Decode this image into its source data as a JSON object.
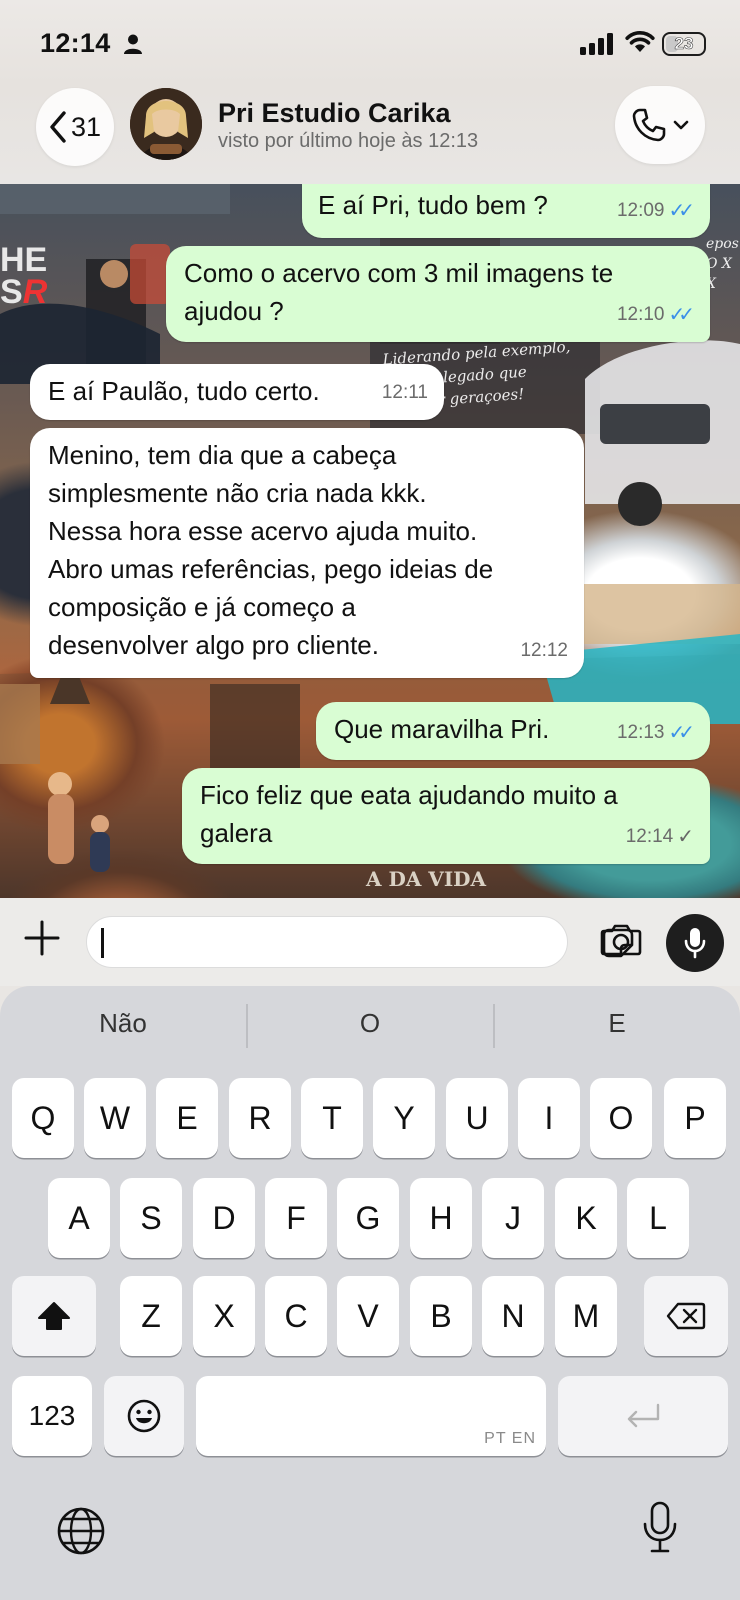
{
  "status_bar": {
    "time": "12:14",
    "battery": "23"
  },
  "header": {
    "back_count": "31",
    "contact_name": "Pri Estudio Carika",
    "last_seen": "visto por último hoje às 12:13"
  },
  "wallpaper": {
    "left_text": "HE",
    "left_text2": "S",
    "left_text_red": "R",
    "right_text": "epos\nO X\nX",
    "quote_lines": [
      "Liderando pela exemplo,",
      "una legado que",
      "rar geraçoes!"
    ],
    "bottom_text": "A DA VIDA"
  },
  "messages": [
    {
      "dir": "out",
      "text": "E aí Pri, tudo bem ?",
      "time": "12:09",
      "status": "read"
    },
    {
      "dir": "out",
      "text": "Como o acervo com 3 mil imagens te ajudou ?",
      "time": "12:10",
      "status": "read"
    },
    {
      "dir": "in",
      "text": "E aí Paulão, tudo certo.",
      "time": "12:11"
    },
    {
      "dir": "in",
      "text": "Menino, tem dia que a cabeça simplesmente não cria nada kkk. Nessa hora esse acervo ajuda muito. Abro umas referências, pego ideias de composição e já começo a desenvolver algo pro cliente.",
      "time": "12:12"
    },
    {
      "dir": "out",
      "text": "Que maravilha Pri.",
      "time": "12:13",
      "status": "read"
    },
    {
      "dir": "out",
      "text": "Fico feliz que eata ajudando muito a galera",
      "time": "12:14",
      "status": "sent"
    }
  ],
  "message_lines": {
    "m2": [
      "Como o acervo com 3 mil imagens te",
      "ajudou ?"
    ],
    "m4": [
      "Menino, tem dia que a cabeça",
      "simplesmente não cria nada kkk.",
      "Nessa hora esse acervo ajuda muito.",
      "Abro umas referências, pego ideias de",
      "composição e já começo a",
      "desenvolver algo pro cliente."
    ],
    "m6": [
      "Fico feliz que eata ajudando muito a",
      "galera"
    ]
  },
  "input": {
    "value": "",
    "placeholder": ""
  },
  "keyboard": {
    "suggestions": [
      "Não",
      "O",
      "E"
    ],
    "row1": [
      "Q",
      "W",
      "E",
      "R",
      "T",
      "Y",
      "U",
      "I",
      "O",
      "P"
    ],
    "row2": [
      "A",
      "S",
      "D",
      "F",
      "G",
      "H",
      "J",
      "K",
      "L"
    ],
    "row3": [
      "Z",
      "X",
      "C",
      "V",
      "B",
      "N",
      "M"
    ],
    "numbers_label": "123",
    "space_lang": "PT EN"
  },
  "colors": {
    "outgoing_bubble": "#d9fdd3",
    "incoming_bubble": "#ffffff",
    "read_ticks": "#3b8fe8"
  }
}
